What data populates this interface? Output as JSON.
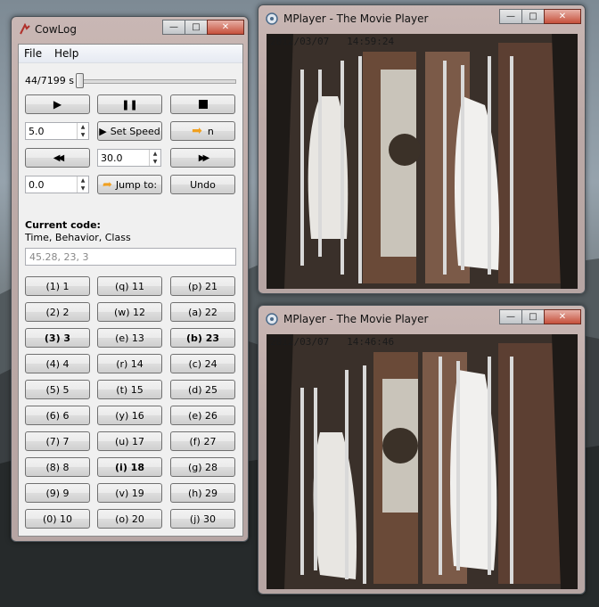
{
  "cowlog": {
    "title": "CowLog",
    "menu": [
      "File",
      "Help"
    ],
    "position_label": "44/7199 s",
    "playback": {
      "play_icon": "play-icon",
      "pause_icon": "pause-icon",
      "stop_icon": "stop-icon"
    },
    "speed_value": "5.0",
    "set_speed_label": "Set Speed",
    "next_label": "n",
    "step_value": "30.0",
    "jump_value": "0.0",
    "jump_label": "Jump to:",
    "undo_label": "Undo",
    "current_code_heading": "Current code:",
    "current_code_columns": "Time, Behavior, Class",
    "current_code_value": "45.28, 23, 3",
    "code_buttons": [
      [
        "(1)  1",
        "(q)  11",
        "(p)  21"
      ],
      [
        "(2)  2",
        "(w)  12",
        "(a)  22"
      ],
      [
        "(3)  3",
        "(e)  13",
        "(b)  23"
      ],
      [
        "(4)  4",
        "(r)  14",
        "(c)  24"
      ],
      [
        "(5)  5",
        "(t)  15",
        "(d)  25"
      ],
      [
        "(6)  6",
        "(y)  16",
        "(e)  26"
      ],
      [
        "(7)  7",
        "(u)  17",
        "(f)  27"
      ],
      [
        "(8)  8",
        "(i)  18",
        "(g)  28"
      ],
      [
        "(9)  9",
        "(v)  19",
        "(h)  29"
      ],
      [
        "(0)  10",
        "(o)  20",
        "(j)  30"
      ]
    ],
    "bold_buttons": [
      "(3)  3",
      "(b)  23",
      "(i)  18"
    ]
  },
  "mplayer_top": {
    "title": "MPlayer - The Movie Player",
    "timestamp": "2012/03/07   14:59:24"
  },
  "mplayer_bottom": {
    "title": "MPlayer - The Movie Player",
    "timestamp": "2012/03/07   14:46:46"
  },
  "colors": {
    "accent_arrow": "#f0a020",
    "close_button": "#c6503b"
  }
}
